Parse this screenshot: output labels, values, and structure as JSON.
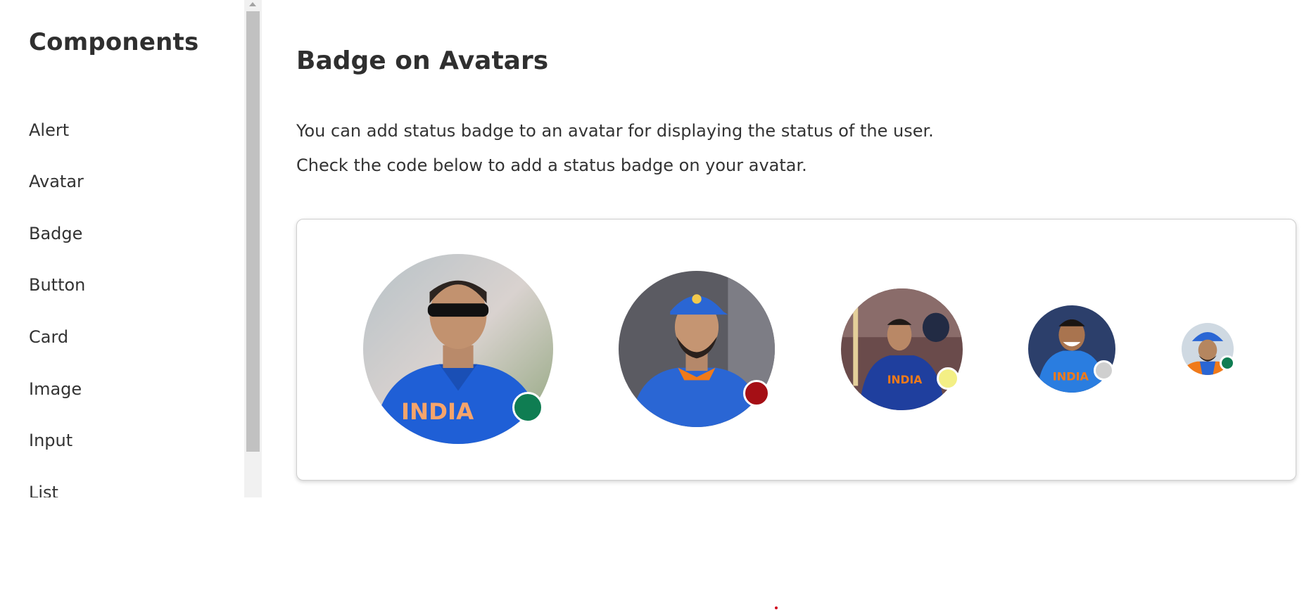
{
  "sidebar": {
    "title": "Components",
    "items": [
      {
        "label": "Alert"
      },
      {
        "label": "Avatar"
      },
      {
        "label": "Badge"
      },
      {
        "label": "Button"
      },
      {
        "label": "Card"
      },
      {
        "label": "Image"
      },
      {
        "label": "Input"
      },
      {
        "label": "List"
      }
    ]
  },
  "main": {
    "title": "Badge on Avatars",
    "description_1": "You can add status badge to an avatar for displaying the status of the user.",
    "description_2": "Check the code below to add a status badge on your avatar."
  },
  "avatars": [
    {
      "icon": "player-photo-icon",
      "status_color": "#0f7d52"
    },
    {
      "icon": "player-photo-icon",
      "status_color": "#a50f15"
    },
    {
      "icon": "player-photo-icon",
      "status_color": "#f3ef85"
    },
    {
      "icon": "player-photo-icon",
      "status_color": "#cfcfcf"
    },
    {
      "icon": "player-photo-icon",
      "status_color": "#0f7d52"
    }
  ],
  "colors": {
    "jersey_blue": "#1f5fd6",
    "jersey_orange": "#f07a1a",
    "text": "#333333"
  }
}
